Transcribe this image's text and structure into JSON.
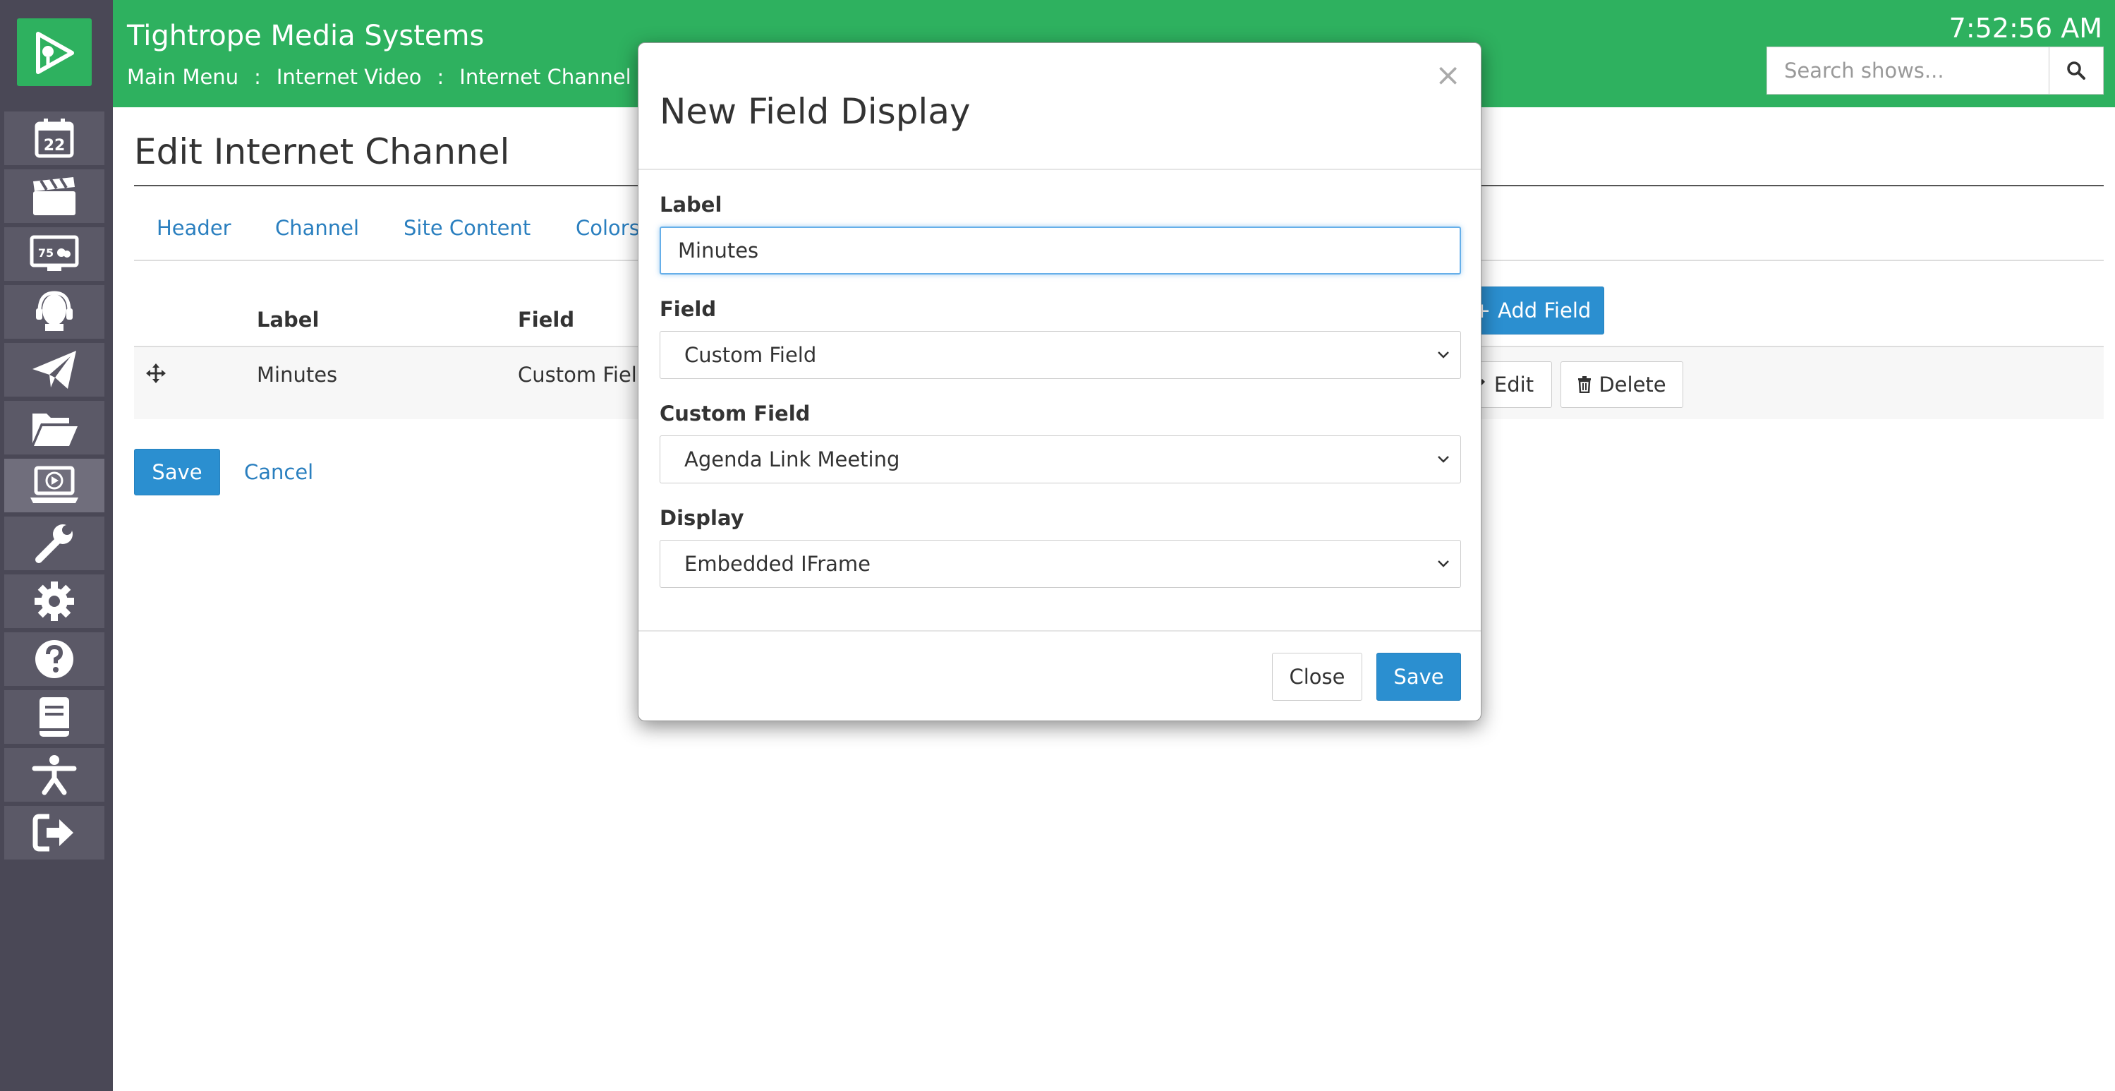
{
  "app": {
    "title": "Tightrope Media Systems",
    "clock": "7:52:56 AM",
    "brand_color": "#2eb15f"
  },
  "breadcrumb": [
    "Main Menu",
    "Internet Video",
    "Internet Channel"
  ],
  "breadcrumb_separator": ":",
  "search": {
    "placeholder": "Search shows..."
  },
  "sidebar": {
    "items": [
      {
        "icon": "calendar-icon",
        "badge": "22"
      },
      {
        "icon": "clapperboard-icon"
      },
      {
        "icon": "display-weather-icon",
        "badge": "75"
      },
      {
        "icon": "headset-icon"
      },
      {
        "icon": "paper-plane-icon"
      },
      {
        "icon": "folder-open-icon"
      },
      {
        "icon": "laptop-play-icon",
        "active": true
      },
      {
        "icon": "wrench-icon"
      },
      {
        "icon": "gear-icon"
      },
      {
        "icon": "help-icon"
      },
      {
        "icon": "book-icon"
      },
      {
        "icon": "accessibility-icon"
      },
      {
        "icon": "logout-icon"
      }
    ]
  },
  "page": {
    "title": "Edit Internet Channel",
    "tabs": [
      "Header",
      "Channel",
      "Site Content",
      "Colors"
    ],
    "table": {
      "headers": [
        "Label",
        "Field"
      ],
      "rows": [
        {
          "label": "Minutes",
          "field": "Custom Field"
        }
      ]
    },
    "add_field_label": "Add Field",
    "edit_label": "Edit",
    "delete_label": "Delete",
    "save_label": "Save",
    "cancel_label": "Cancel"
  },
  "modal": {
    "title": "New Field Display",
    "close_x": "×",
    "label_caption": "Label",
    "label_value": "Minutes",
    "field_caption": "Field",
    "field_value": "Custom Field",
    "custom_field_caption": "Custom Field",
    "custom_field_value": "Agenda Link Meeting",
    "display_caption": "Display",
    "display_value": "Embedded IFrame",
    "close_label": "Close",
    "save_label": "Save"
  }
}
